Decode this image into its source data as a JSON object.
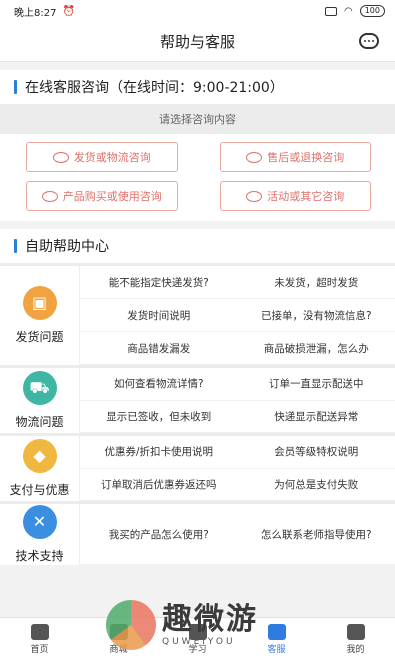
{
  "status_bar": {
    "time": "晚上8:27",
    "battery": "100"
  },
  "header": {
    "title": "帮助与客服",
    "chat_icon": "chat-bubble-icon"
  },
  "online": {
    "heading": "在线客服咨询（在线时间：9:00-21:00）",
    "hint": "请选择咨询内容",
    "buttons": [
      "发货或物流咨询",
      "售后或退换咨询",
      "产品购买或使用咨询",
      "活动或其它咨询"
    ]
  },
  "self_help": {
    "heading": "自助帮助中心",
    "categories": [
      {
        "label": "发货问题",
        "color": "#f0a340",
        "items": [
          "能不能指定快递发货?",
          "未发货，超时发货",
          "发货时间说明",
          "已接单，没有物流信息?",
          "商品错发漏发",
          "商品破损泄漏，怎么办"
        ]
      },
      {
        "label": "物流问题",
        "color": "#3fb6a3",
        "items": [
          "如何查看物流详情?",
          "订单一直显示配送中",
          "显示已签收，但未收到",
          "快递显示配送异常"
        ]
      },
      {
        "label": "支付与优惠",
        "color": "#f0b840",
        "items": [
          "优惠券/折扣卡使用说明",
          "会员等级特权说明",
          "订单取消后优惠券返还吗",
          "为何总是支付失败"
        ]
      },
      {
        "label": "技术支持",
        "color": "#3a8fe0",
        "items": [
          "我买的产品怎么使用?",
          "怎么联系老师指导使用?"
        ]
      }
    ]
  },
  "tabbar": {
    "tabs": [
      "首页",
      "商城",
      "学习",
      "客服",
      "我的"
    ],
    "active": 3
  },
  "watermark": {
    "cn": "趣微游",
    "en": "QUWEIYOU"
  }
}
